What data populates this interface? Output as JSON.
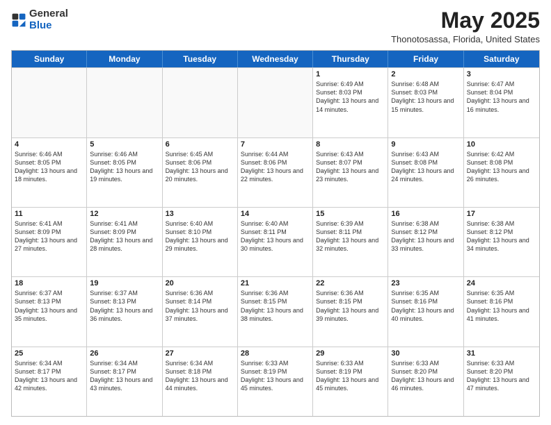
{
  "header": {
    "logo": {
      "general": "General",
      "blue": "Blue"
    },
    "title": "May 2025",
    "location": "Thonotosassa, Florida, United States"
  },
  "days_of_week": [
    "Sunday",
    "Monday",
    "Tuesday",
    "Wednesday",
    "Thursday",
    "Friday",
    "Saturday"
  ],
  "weeks": [
    [
      {
        "day": "",
        "text": ""
      },
      {
        "day": "",
        "text": ""
      },
      {
        "day": "",
        "text": ""
      },
      {
        "day": "",
        "text": ""
      },
      {
        "day": "1",
        "text": "Sunrise: 6:49 AM\nSunset: 8:03 PM\nDaylight: 13 hours and 14 minutes."
      },
      {
        "day": "2",
        "text": "Sunrise: 6:48 AM\nSunset: 8:03 PM\nDaylight: 13 hours and 15 minutes."
      },
      {
        "day": "3",
        "text": "Sunrise: 6:47 AM\nSunset: 8:04 PM\nDaylight: 13 hours and 16 minutes."
      }
    ],
    [
      {
        "day": "4",
        "text": "Sunrise: 6:46 AM\nSunset: 8:05 PM\nDaylight: 13 hours and 18 minutes."
      },
      {
        "day": "5",
        "text": "Sunrise: 6:46 AM\nSunset: 8:05 PM\nDaylight: 13 hours and 19 minutes."
      },
      {
        "day": "6",
        "text": "Sunrise: 6:45 AM\nSunset: 8:06 PM\nDaylight: 13 hours and 20 minutes."
      },
      {
        "day": "7",
        "text": "Sunrise: 6:44 AM\nSunset: 8:06 PM\nDaylight: 13 hours and 22 minutes."
      },
      {
        "day": "8",
        "text": "Sunrise: 6:43 AM\nSunset: 8:07 PM\nDaylight: 13 hours and 23 minutes."
      },
      {
        "day": "9",
        "text": "Sunrise: 6:43 AM\nSunset: 8:08 PM\nDaylight: 13 hours and 24 minutes."
      },
      {
        "day": "10",
        "text": "Sunrise: 6:42 AM\nSunset: 8:08 PM\nDaylight: 13 hours and 26 minutes."
      }
    ],
    [
      {
        "day": "11",
        "text": "Sunrise: 6:41 AM\nSunset: 8:09 PM\nDaylight: 13 hours and 27 minutes."
      },
      {
        "day": "12",
        "text": "Sunrise: 6:41 AM\nSunset: 8:09 PM\nDaylight: 13 hours and 28 minutes."
      },
      {
        "day": "13",
        "text": "Sunrise: 6:40 AM\nSunset: 8:10 PM\nDaylight: 13 hours and 29 minutes."
      },
      {
        "day": "14",
        "text": "Sunrise: 6:40 AM\nSunset: 8:11 PM\nDaylight: 13 hours and 30 minutes."
      },
      {
        "day": "15",
        "text": "Sunrise: 6:39 AM\nSunset: 8:11 PM\nDaylight: 13 hours and 32 minutes."
      },
      {
        "day": "16",
        "text": "Sunrise: 6:38 AM\nSunset: 8:12 PM\nDaylight: 13 hours and 33 minutes."
      },
      {
        "day": "17",
        "text": "Sunrise: 6:38 AM\nSunset: 8:12 PM\nDaylight: 13 hours and 34 minutes."
      }
    ],
    [
      {
        "day": "18",
        "text": "Sunrise: 6:37 AM\nSunset: 8:13 PM\nDaylight: 13 hours and 35 minutes."
      },
      {
        "day": "19",
        "text": "Sunrise: 6:37 AM\nSunset: 8:13 PM\nDaylight: 13 hours and 36 minutes."
      },
      {
        "day": "20",
        "text": "Sunrise: 6:36 AM\nSunset: 8:14 PM\nDaylight: 13 hours and 37 minutes."
      },
      {
        "day": "21",
        "text": "Sunrise: 6:36 AM\nSunset: 8:15 PM\nDaylight: 13 hours and 38 minutes."
      },
      {
        "day": "22",
        "text": "Sunrise: 6:36 AM\nSunset: 8:15 PM\nDaylight: 13 hours and 39 minutes."
      },
      {
        "day": "23",
        "text": "Sunrise: 6:35 AM\nSunset: 8:16 PM\nDaylight: 13 hours and 40 minutes."
      },
      {
        "day": "24",
        "text": "Sunrise: 6:35 AM\nSunset: 8:16 PM\nDaylight: 13 hours and 41 minutes."
      }
    ],
    [
      {
        "day": "25",
        "text": "Sunrise: 6:34 AM\nSunset: 8:17 PM\nDaylight: 13 hours and 42 minutes."
      },
      {
        "day": "26",
        "text": "Sunrise: 6:34 AM\nSunset: 8:17 PM\nDaylight: 13 hours and 43 minutes."
      },
      {
        "day": "27",
        "text": "Sunrise: 6:34 AM\nSunset: 8:18 PM\nDaylight: 13 hours and 44 minutes."
      },
      {
        "day": "28",
        "text": "Sunrise: 6:33 AM\nSunset: 8:19 PM\nDaylight: 13 hours and 45 minutes."
      },
      {
        "day": "29",
        "text": "Sunrise: 6:33 AM\nSunset: 8:19 PM\nDaylight: 13 hours and 45 minutes."
      },
      {
        "day": "30",
        "text": "Sunrise: 6:33 AM\nSunset: 8:20 PM\nDaylight: 13 hours and 46 minutes."
      },
      {
        "day": "31",
        "text": "Sunrise: 6:33 AM\nSunset: 8:20 PM\nDaylight: 13 hours and 47 minutes."
      }
    ]
  ]
}
